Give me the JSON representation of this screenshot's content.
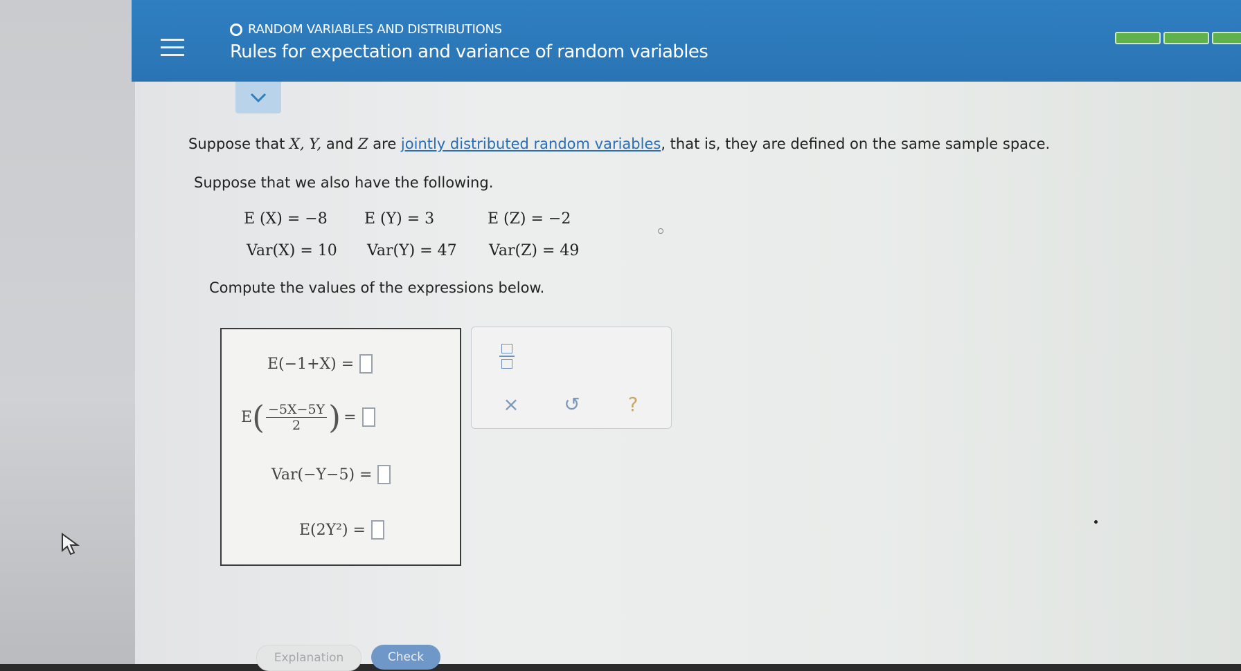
{
  "header": {
    "topic": "RANDOM VARIABLES AND DISTRIBUTIONS",
    "title": "Rules for expectation and variance of random variables",
    "progress_segments": 3,
    "progress_color": "#5fb24b",
    "accent_color": "#2f7fc1"
  },
  "intro": {
    "part_a": "Suppose that ",
    "vars": "X, Y,",
    "and": " and ",
    "var_z": "Z",
    "are": " are ",
    "link_text": "jointly distributed random variables",
    "part_b": ", that is, they are defined on the same sample space."
  },
  "also": "Suppose that we also have the following.",
  "given": {
    "ex": "E (X) = −8",
    "ey": "E (Y) = 3",
    "ez": "E (Z) = −2",
    "varx": "Var(X) = 10",
    "vary": "Var(Y) = 47",
    "varz": "Var(Z) = 49"
  },
  "compute": "Compute the values of the expressions below.",
  "expressions": {
    "e1": "E(−1+X) =",
    "e2_prefix": "E",
    "e2_num": "−5X−5Y",
    "e2_den": "2",
    "e2_eq": "=",
    "e3": "Var(−Y−5) =",
    "e4": "E(2Y²) ="
  },
  "tools": {
    "clear_icon": "×",
    "undo_icon": "↺",
    "help_icon": "?"
  },
  "buttons": {
    "explanation": "Explanation",
    "check": "Check"
  }
}
